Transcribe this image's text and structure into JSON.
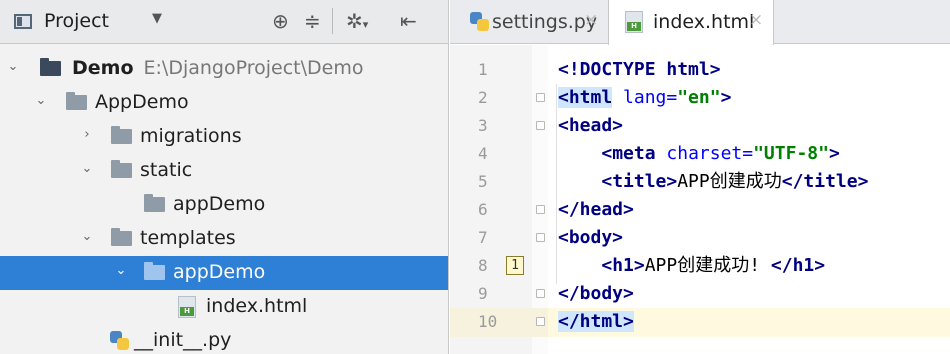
{
  "project_panel": {
    "title": "Project",
    "dropdown_icon": "triangle-down",
    "toolbar_icons": [
      "crosshair-icon",
      "collapse-all-icon",
      "gear-icon",
      "hide-panel-icon"
    ],
    "tree": [
      {
        "name": "Demo",
        "path": "E:\\DjangoProject\\Demo",
        "type": "folder",
        "expanded": true
      },
      {
        "name": "AppDemo",
        "type": "folder",
        "expanded": true
      },
      {
        "name": "migrations",
        "type": "folder",
        "expanded": false
      },
      {
        "name": "static",
        "type": "folder",
        "expanded": true
      },
      {
        "name": "appDemo",
        "type": "folder"
      },
      {
        "name": "templates",
        "type": "folder",
        "expanded": true
      },
      {
        "name": "appDemo",
        "type": "folder",
        "expanded": true,
        "selected": true
      },
      {
        "name": "index.html",
        "type": "html-file"
      },
      {
        "name": "__init__.py",
        "type": "python-file"
      }
    ]
  },
  "editor": {
    "tabs": [
      {
        "label": "settings.py",
        "active": false
      },
      {
        "label": "index.html",
        "active": true
      }
    ],
    "close_glyph": "×",
    "current_line": 10,
    "bookmark_label": "1",
    "lines": [
      {
        "num": "1",
        "text": "<!DOCTYPE html>"
      },
      {
        "num": "2",
        "text": "<html lang=\"en\">"
      },
      {
        "num": "3",
        "text": "<head>"
      },
      {
        "num": "4",
        "text": "<meta charset=\"UTF-8\">"
      },
      {
        "num": "5",
        "text": "<title>APP创建成功</title>"
      },
      {
        "num": "6",
        "text": "</head>"
      },
      {
        "num": "7",
        "text": "<body>"
      },
      {
        "num": "8",
        "text": "<h1>APP创建成功! </h1>"
      },
      {
        "num": "9",
        "text": "</body>"
      },
      {
        "num": "10",
        "text": "</html>"
      }
    ]
  },
  "colors": {
    "selection": "#2e7fd6",
    "tag": "#000080",
    "attr": "#0000ff",
    "string": "#008000",
    "current_line": "#fff9e0"
  }
}
